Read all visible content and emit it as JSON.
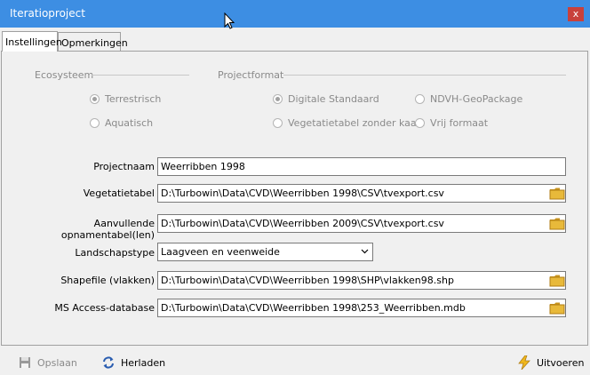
{
  "window": {
    "title": "Iteratioproject",
    "close_glyph": "x"
  },
  "tabs": [
    {
      "label": "Instellingen",
      "active": true
    },
    {
      "label": "Opmerkingen",
      "active": false
    }
  ],
  "ecosysteem": {
    "label": "Ecosysteem",
    "options": [
      {
        "label": "Terrestrisch",
        "checked": true
      },
      {
        "label": "Aquatisch",
        "checked": false
      }
    ]
  },
  "projectformat": {
    "label": "Projectformat",
    "options": [
      {
        "label": "Digitale Standaard",
        "checked": true
      },
      {
        "label": "NDVH-GeoPackage",
        "checked": false
      },
      {
        "label": "Vegetatietabel zonder kaart",
        "checked": false
      },
      {
        "label": "Vrij formaat",
        "checked": false
      }
    ]
  },
  "fields": {
    "projectnaam": {
      "label": "Projectnaam",
      "value": "Weerribben 1998"
    },
    "vegetatietabel": {
      "label": "Vegetatietabel",
      "value": "D:\\Turbowin\\Data\\CVD\\Weerribben 1998\\CSV\\tvexport.csv"
    },
    "aanvullende": {
      "label": "Aanvullende opnamentabel(len)",
      "value": "D:\\Turbowin\\Data\\CVD\\Weerribben 2009\\CSV\\tvexport.csv"
    },
    "landschapstype": {
      "label": "Landschapstype",
      "value": "Laagveen en veenweide"
    },
    "shapefile": {
      "label": "Shapefile (vlakken)",
      "value": "D:\\Turbowin\\Data\\CVD\\Weerribben 1998\\SHP\\vlakken98.shp"
    },
    "access": {
      "label": "MS Access-database",
      "value": "D:\\Turbowin\\Data\\CVD\\Weerribben 1998\\253_Weerribben.mdb"
    }
  },
  "footer": {
    "save_label": "Opslaan",
    "reload_label": "Herladen",
    "run_label": "Uitvoeren"
  },
  "colors": {
    "titlebar": "#3d8ee3",
    "close": "#c8413c",
    "folder": "#e8b93a"
  }
}
